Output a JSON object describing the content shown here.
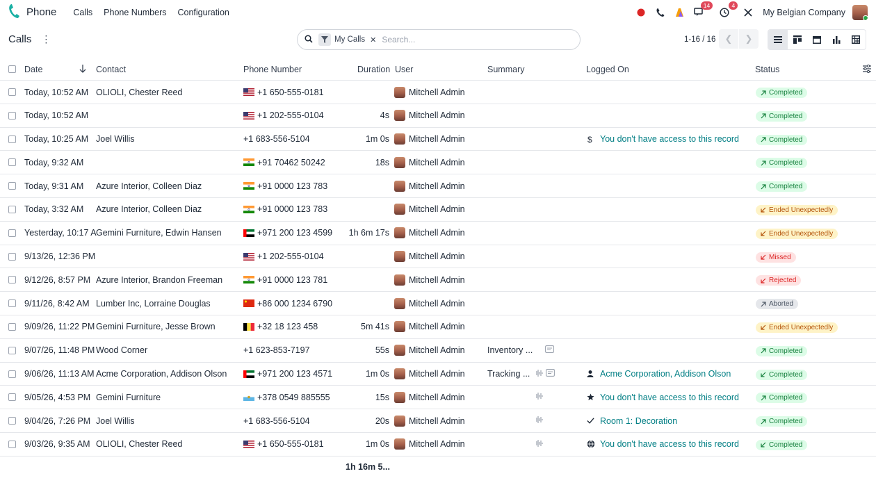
{
  "app": {
    "name": "Phone",
    "menu": [
      "Calls",
      "Phone Numbers",
      "Configuration"
    ],
    "badges": {
      "messages": "14",
      "activities": "4"
    },
    "company": "My Belgian Company"
  },
  "control": {
    "breadcrumb": "Calls",
    "facet": "My Calls",
    "search_placeholder": "Search...",
    "pager": "1-16 / 16"
  },
  "columns": {
    "date": "Date",
    "contact": "Contact",
    "phone": "Phone Number",
    "duration": "Duration",
    "user": "User",
    "summary": "Summary",
    "logged_on": "Logged On",
    "status": "Status"
  },
  "colors": {
    "accent": "#017e84",
    "completed": "#15803d",
    "ended": "#b45309",
    "missed": "#dc2626",
    "aborted": "#4b5563"
  },
  "rows": [
    {
      "date": "Today, 10:52 AM",
      "contact": "OLIOLI, Chester Reed",
      "flag": "us",
      "phone": "+1 650-555-0181",
      "duration": "",
      "user": "Mitchell Admin",
      "summary": "",
      "icons": "",
      "logged_icon": "",
      "logged": "",
      "status": "Completed",
      "kind": "completed",
      "dir": "out"
    },
    {
      "date": "Today, 10:52 AM",
      "contact": "",
      "flag": "us",
      "phone": "+1 202-555-0104",
      "duration": "4s",
      "user": "Mitchell Admin",
      "summary": "",
      "icons": "",
      "logged_icon": "",
      "logged": "",
      "status": "Completed",
      "kind": "completed",
      "dir": "out"
    },
    {
      "date": "Today, 10:25 AM",
      "contact": "Joel Willis",
      "flag": "",
      "phone": "+1 683-556-5104",
      "duration": "1m 0s",
      "user": "Mitchell Admin",
      "summary": "",
      "icons": "",
      "logged_icon": "dollar",
      "logged": "You don't have access to this record",
      "status": "Completed",
      "kind": "completed",
      "dir": "out"
    },
    {
      "date": "Today, 9:32 AM",
      "contact": "",
      "flag": "in",
      "phone": "+91 70462 50242",
      "duration": "18s",
      "user": "Mitchell Admin",
      "summary": "",
      "icons": "",
      "logged_icon": "",
      "logged": "",
      "status": "Completed",
      "kind": "completed",
      "dir": "out"
    },
    {
      "date": "Today, 9:31 AM",
      "contact": "Azure Interior, Colleen Diaz",
      "flag": "in",
      "phone": "+91 0000 123 783",
      "duration": "",
      "user": "Mitchell Admin",
      "summary": "",
      "icons": "",
      "logged_icon": "",
      "logged": "",
      "status": "Completed",
      "kind": "completed",
      "dir": "out"
    },
    {
      "date": "Today, 3:32 AM",
      "contact": "Azure Interior, Colleen Diaz",
      "flag": "in",
      "phone": "+91 0000 123 783",
      "duration": "",
      "user": "Mitchell Admin",
      "summary": "",
      "icons": "",
      "logged_icon": "",
      "logged": "",
      "status": "Ended Unexpectedly",
      "kind": "ended",
      "dir": "in"
    },
    {
      "date": "Yesterday, 10:17 A",
      "contact": "Gemini Furniture, Edwin Hansen",
      "flag": "ae",
      "phone": "+971 200 123 4599",
      "duration": "1h 6m 17s",
      "user": "Mitchell Admin",
      "summary": "",
      "icons": "",
      "logged_icon": "",
      "logged": "",
      "status": "Ended Unexpectedly",
      "kind": "ended",
      "dir": "in"
    },
    {
      "date": "9/13/26, 12:36 PM",
      "contact": "",
      "flag": "us",
      "phone": "+1 202-555-0104",
      "duration": "",
      "user": "Mitchell Admin",
      "summary": "",
      "icons": "",
      "logged_icon": "",
      "logged": "",
      "status": "Missed",
      "kind": "missed",
      "dir": "in"
    },
    {
      "date": "9/12/26, 8:57 PM",
      "contact": "Azure Interior, Brandon Freeman",
      "flag": "in",
      "phone": "+91 0000 123 781",
      "duration": "",
      "user": "Mitchell Admin",
      "summary": "",
      "icons": "",
      "logged_icon": "",
      "logged": "",
      "status": "Rejected",
      "kind": "rejected",
      "dir": "in"
    },
    {
      "date": "9/11/26, 8:42 AM",
      "contact": "Lumber Inc, Lorraine Douglas",
      "flag": "cn",
      "phone": "+86 000 1234 6790",
      "duration": "",
      "user": "Mitchell Admin",
      "summary": "",
      "icons": "",
      "logged_icon": "",
      "logged": "",
      "status": "Aborted",
      "kind": "aborted",
      "dir": "out"
    },
    {
      "date": "9/09/26, 11:22 PM",
      "contact": "Gemini Furniture, Jesse Brown",
      "flag": "be",
      "phone": "+32 18 123 458",
      "duration": "5m 41s",
      "user": "Mitchell Admin",
      "summary": "",
      "icons": "",
      "logged_icon": "",
      "logged": "",
      "status": "Ended Unexpectedly",
      "kind": "ended",
      "dir": "in"
    },
    {
      "date": "9/07/26, 11:48 PM",
      "contact": "Wood Corner",
      "flag": "",
      "phone": "+1 623-853-7197",
      "duration": "55s",
      "user": "Mitchell Admin",
      "summary": "Inventory ...",
      "icons": "note",
      "logged_icon": "",
      "logged": "",
      "status": "Completed",
      "kind": "completed",
      "dir": "out"
    },
    {
      "date": "9/06/26, 11:13 AM",
      "contact": "Acme Corporation, Addison Olson",
      "flag": "ae",
      "phone": "+971 200 123 4571",
      "duration": "1m 0s",
      "user": "Mitchell Admin",
      "summary": "Tracking ...",
      "icons": "wave-note",
      "logged_icon": "person",
      "logged": "Acme Corporation, Addison Olson",
      "status": "Completed",
      "kind": "completed",
      "dir": "in"
    },
    {
      "date": "9/05/26, 4:53 PM",
      "contact": "Gemini Furniture",
      "flag": "sm",
      "phone": "+378 0549 885555",
      "duration": "15s",
      "user": "Mitchell Admin",
      "summary": "",
      "icons": "wave",
      "logged_icon": "star",
      "logged": "You don't have access to this record",
      "status": "Completed",
      "kind": "completed",
      "dir": "out"
    },
    {
      "date": "9/04/26, 7:26 PM",
      "contact": "Joel Willis",
      "flag": "",
      "phone": "+1 683-556-5104",
      "duration": "20s",
      "user": "Mitchell Admin",
      "summary": "",
      "icons": "wave",
      "logged_icon": "check",
      "logged": "Room 1: Decoration",
      "status": "Completed",
      "kind": "completed",
      "dir": "out"
    },
    {
      "date": "9/03/26, 9:35 AM",
      "contact": "OLIOLI, Chester Reed",
      "flag": "us",
      "phone": "+1 650-555-0181",
      "duration": "1m 0s",
      "user": "Mitchell Admin",
      "summary": "",
      "icons": "wave",
      "logged_icon": "globe",
      "logged": "You don't have access to this record",
      "status": "Completed",
      "kind": "completed",
      "dir": "in"
    }
  ],
  "footer": {
    "total_duration": "1h 16m 5..."
  }
}
